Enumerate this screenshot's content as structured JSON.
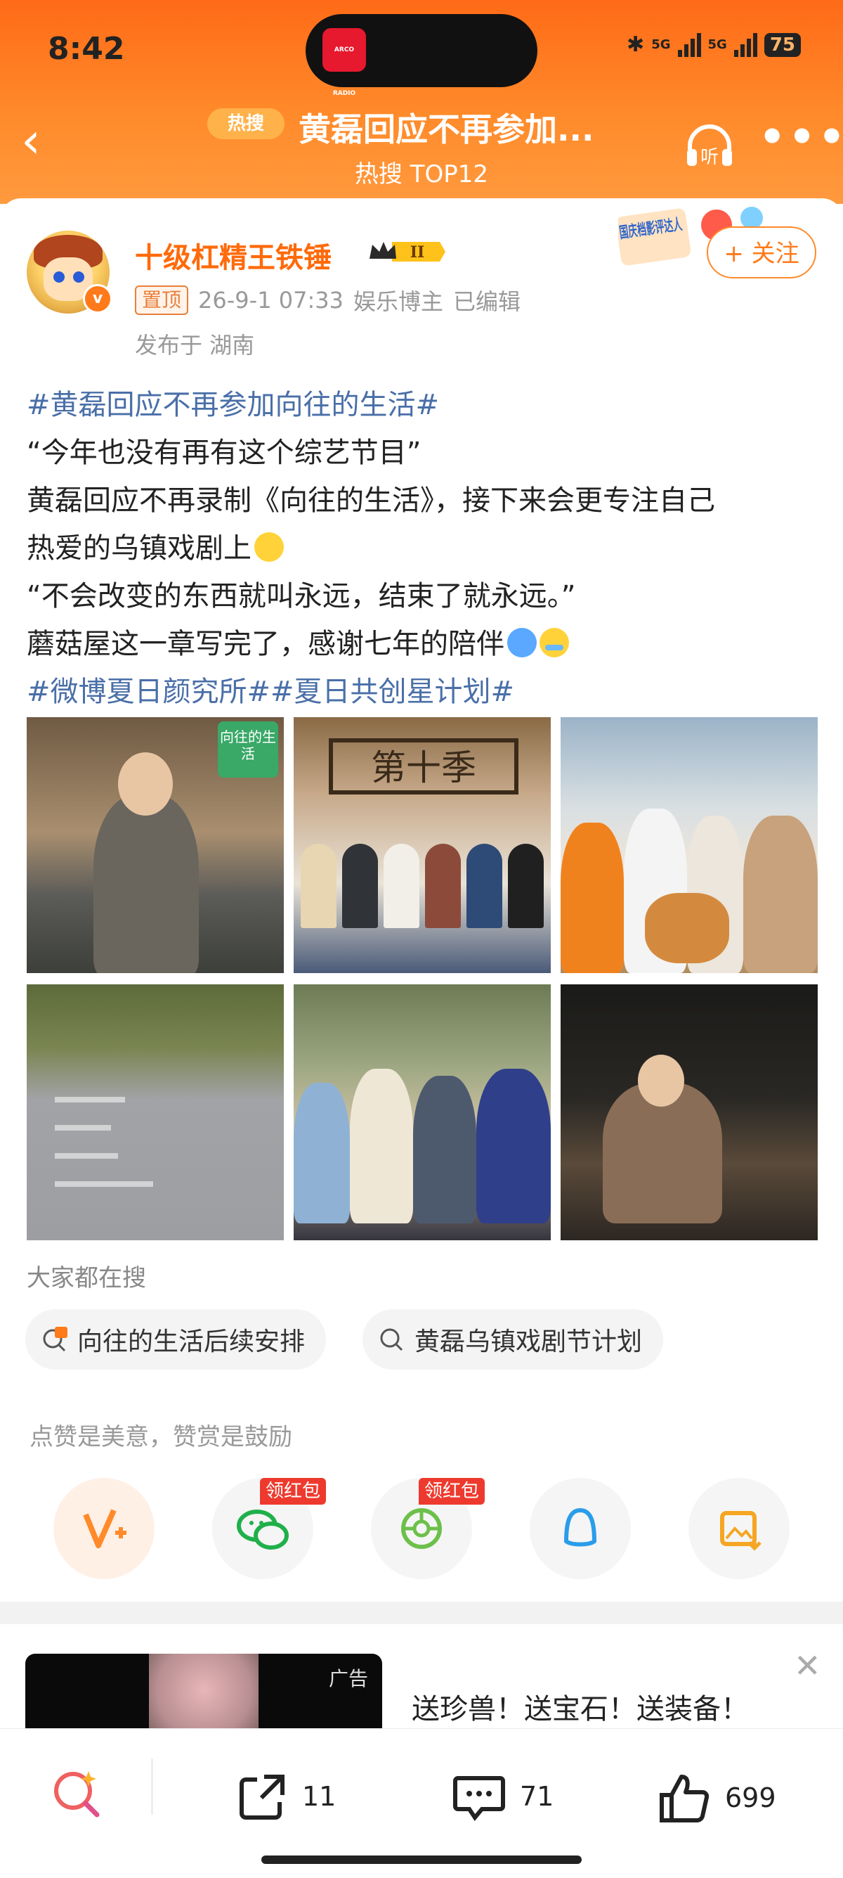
{
  "status_bar": {
    "time": "8:42",
    "network1": "5G",
    "network2": "5G",
    "battery": "75",
    "island_app": "ARCO RADIO"
  },
  "nav": {
    "hot_pill": "热搜",
    "title": "黄磊回应不再参加...",
    "subtitle": "热搜 TOP12"
  },
  "author": {
    "name": "十级杠精王铁锤",
    "level": "II",
    "pin_tag": "置顶",
    "date": "26-9-1 07:33",
    "role": "娱乐博主",
    "edited": "已编辑",
    "location": "发布于 湖南",
    "follow_label": "+ 关注",
    "sticker_text": "国庆档影评达人"
  },
  "post": {
    "tag1": "#黄磊回应不再参加向往的生活#",
    "line2": "“今年也没有再有这个综艺节目”",
    "line3": "黄磊回应不再录制《向往的生活》，接下来会更专注自己",
    "line4": "热爱的乌镇戏剧上",
    "line5": "“不会改变的东西就叫永远，结束了就永远。”",
    "line6": "蘑菇屋这一章写完了，感谢七年的陪伴",
    "tags2": "#微博夏日颜究所##夏日共创星计划#"
  },
  "photos": {
    "p1_badge": "向往的生活",
    "p2_sign": "第十季"
  },
  "everyone_searching": {
    "heading": "大家都在搜",
    "chips": [
      "向往的生活后续安排",
      "黄磊乌镇戏剧节计划"
    ]
  },
  "reward": {
    "tip": "点赞是美意，赞赏是鼓励",
    "redpack1": "领红包",
    "redpack2": "领红包"
  },
  "ad": {
    "label": "广告",
    "text": "送珍兽！送宝石！送装备！"
  },
  "bottom": {
    "share_count": "11",
    "comment_count": "71",
    "like_count": "699"
  }
}
